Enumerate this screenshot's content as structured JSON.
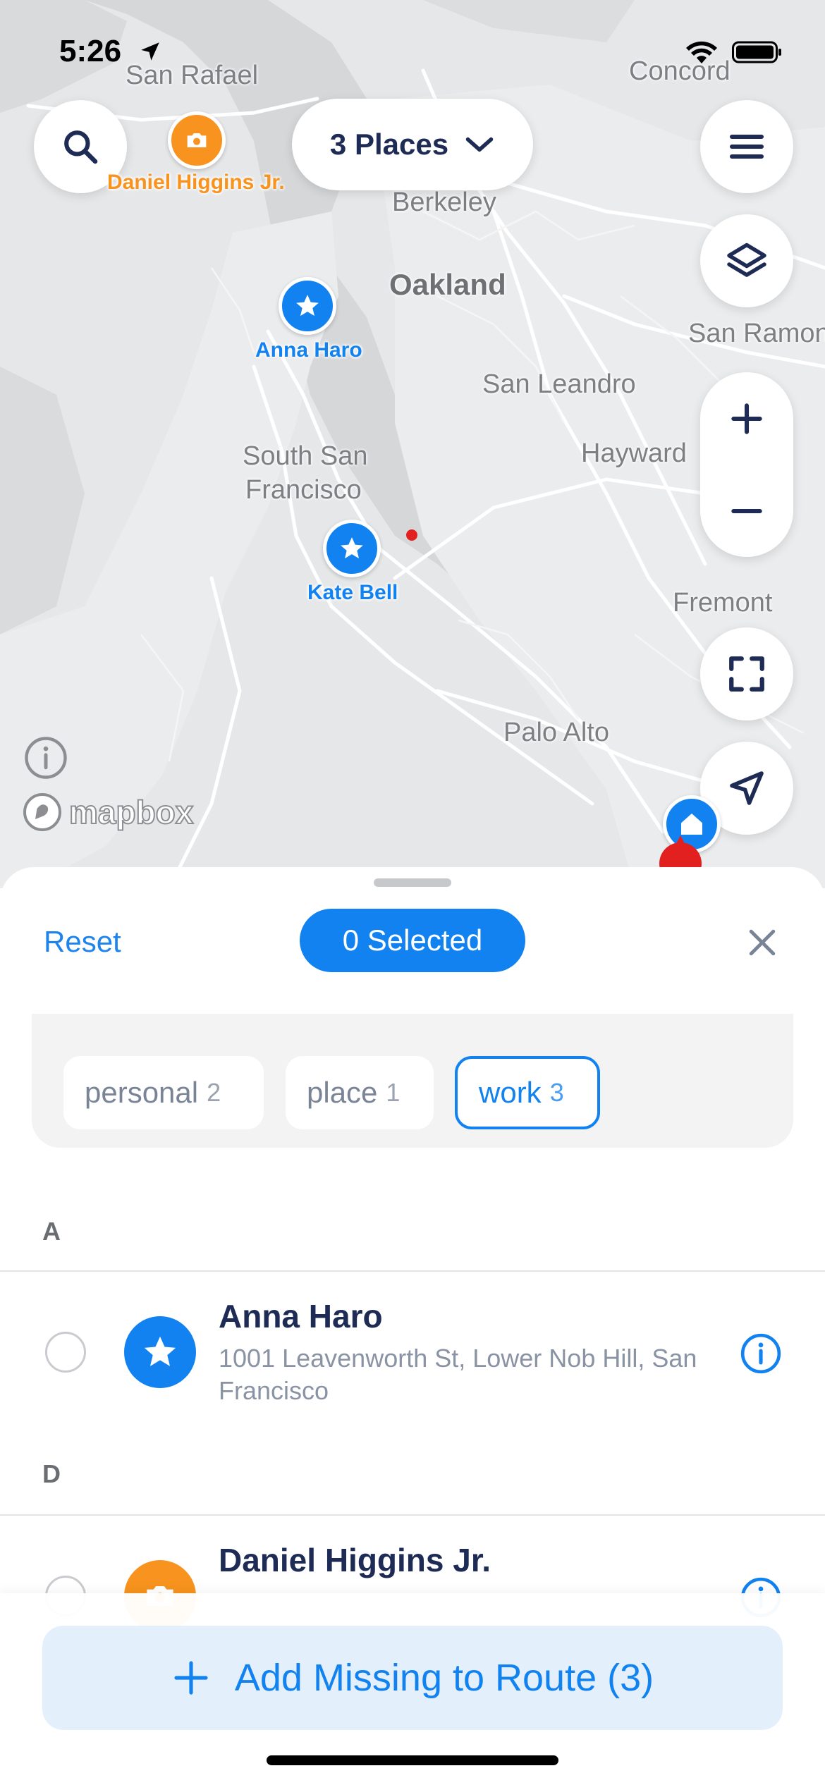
{
  "status_bar": {
    "time": "5:26"
  },
  "map": {
    "places_button_label": "3 Places",
    "labels": [
      {
        "name": "San Rafael"
      },
      {
        "name": "Concord"
      },
      {
        "name": "Berkeley"
      },
      {
        "name": "Oakland"
      },
      {
        "name": "San Ramon"
      },
      {
        "name": "San Leandro"
      },
      {
        "name": "South San"
      },
      {
        "name": "Francisco"
      },
      {
        "name": "Hayward"
      },
      {
        "name": "Fremont"
      },
      {
        "name": "Palo Alto"
      }
    ],
    "pins": [
      {
        "name": "Daniel Higgins Jr.",
        "icon": "camera-icon",
        "color": "#f7931e"
      },
      {
        "name": "Anna Haro",
        "icon": "star-icon",
        "color": "#1282f1"
      },
      {
        "name": "Kate Bell",
        "icon": "star-icon",
        "color": "#1282f1"
      }
    ],
    "attribution": "mapbox"
  },
  "sheet": {
    "reset_label": "Reset",
    "selected_label": "0 Selected",
    "filters": [
      {
        "label": "personal",
        "count": "2",
        "active": false
      },
      {
        "label": "place",
        "count": "1",
        "active": false
      },
      {
        "label": "work",
        "count": "3",
        "active": true
      }
    ],
    "sections": [
      {
        "letter": "A",
        "items": [
          {
            "name": "Anna Haro",
            "address": "1001 Leavenworth St, Lower Nob Hill, San Francisco",
            "icon": "star-icon",
            "color": "#1282f1"
          }
        ]
      },
      {
        "letter": "D",
        "items": [
          {
            "name": "Daniel Higgins Jr.",
            "address": "",
            "icon": "camera-icon",
            "color": "#f7931e"
          }
        ]
      }
    ],
    "add_button_label": "Add Missing to Route (3)"
  },
  "colors": {
    "accent": "#1282f1",
    "orange": "#f7931e",
    "navy": "#1d2b55"
  }
}
